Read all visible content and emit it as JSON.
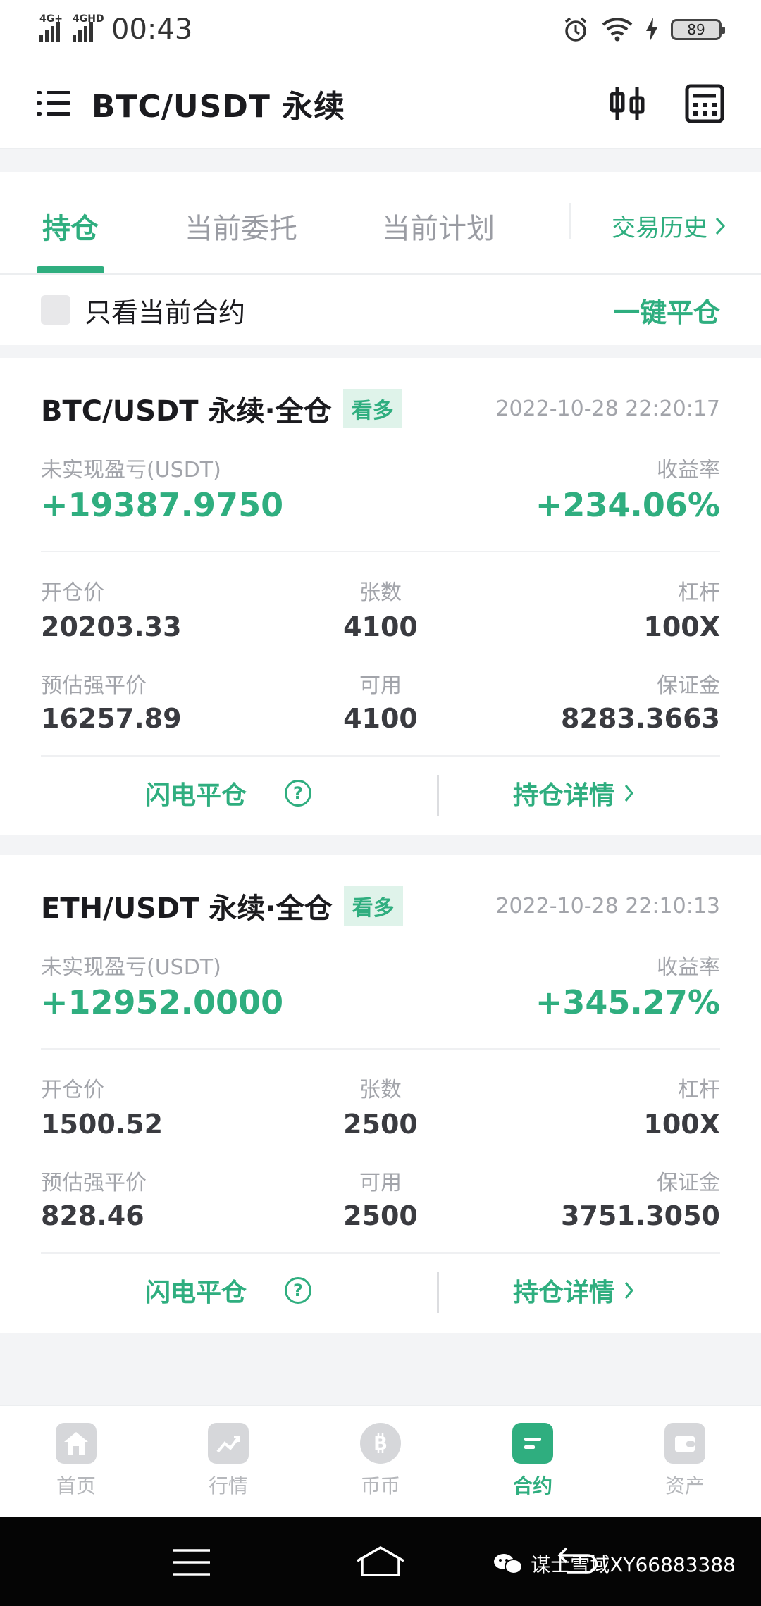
{
  "status_bar": {
    "signal1_label": "4G+",
    "signal2_label": "4GHD",
    "time": "00:43",
    "battery": "89"
  },
  "header": {
    "title": "BTC/USDT 永续"
  },
  "tabs": {
    "positions": "持仓",
    "current_orders": "当前委托",
    "current_plans": "当前计划",
    "history": "交易历史"
  },
  "filter": {
    "only_current_label": "只看当前合约",
    "close_all": "一键平仓"
  },
  "positions": [
    {
      "pair": "BTC/USDT 永续·全仓",
      "side": "看多",
      "timestamp": "2022-10-28 22:20:17",
      "pnl_label": "未实现盈亏(USDT)",
      "pnl": "+19387.9750",
      "roe_label": "收益率",
      "roe": "+234.06%",
      "open_price_label": "开仓价",
      "open_price": "20203.33",
      "contracts_label": "张数",
      "contracts": "4100",
      "leverage_label": "杠杆",
      "leverage": "100X",
      "liq_price_label": "预估强平价",
      "liq_price": "16257.89",
      "available_label": "可用",
      "available": "4100",
      "margin_label": "保证金",
      "margin": "8283.3663",
      "flash_close": "闪电平仓",
      "details": "持仓详情"
    },
    {
      "pair": "ETH/USDT 永续·全仓",
      "side": "看多",
      "timestamp": "2022-10-28 22:10:13",
      "pnl_label": "未实现盈亏(USDT)",
      "pnl": "+12952.0000",
      "roe_label": "收益率",
      "roe": "+345.27%",
      "open_price_label": "开仓价",
      "open_price": "1500.52",
      "contracts_label": "张数",
      "contracts": "2500",
      "leverage_label": "杠杆",
      "leverage": "100X",
      "liq_price_label": "预估强平价",
      "liq_price": "828.46",
      "available_label": "可用",
      "available": "2500",
      "margin_label": "保证金",
      "margin": "3751.3050",
      "flash_close": "闪电平仓",
      "details": "持仓详情"
    }
  ],
  "bottom_nav": [
    {
      "label": "首页",
      "icon": "home-icon"
    },
    {
      "label": "行情",
      "icon": "chart-icon"
    },
    {
      "label": "币币",
      "icon": "bitcoin-icon"
    },
    {
      "label": "合约",
      "icon": "contract-icon"
    },
    {
      "label": "资产",
      "icon": "wallet-icon"
    }
  ],
  "watermark": "谋士雪域XY66883388",
  "colors": {
    "accent": "#2fae7f",
    "text": "#1b1b1f",
    "muted": "#a2a4aa"
  }
}
